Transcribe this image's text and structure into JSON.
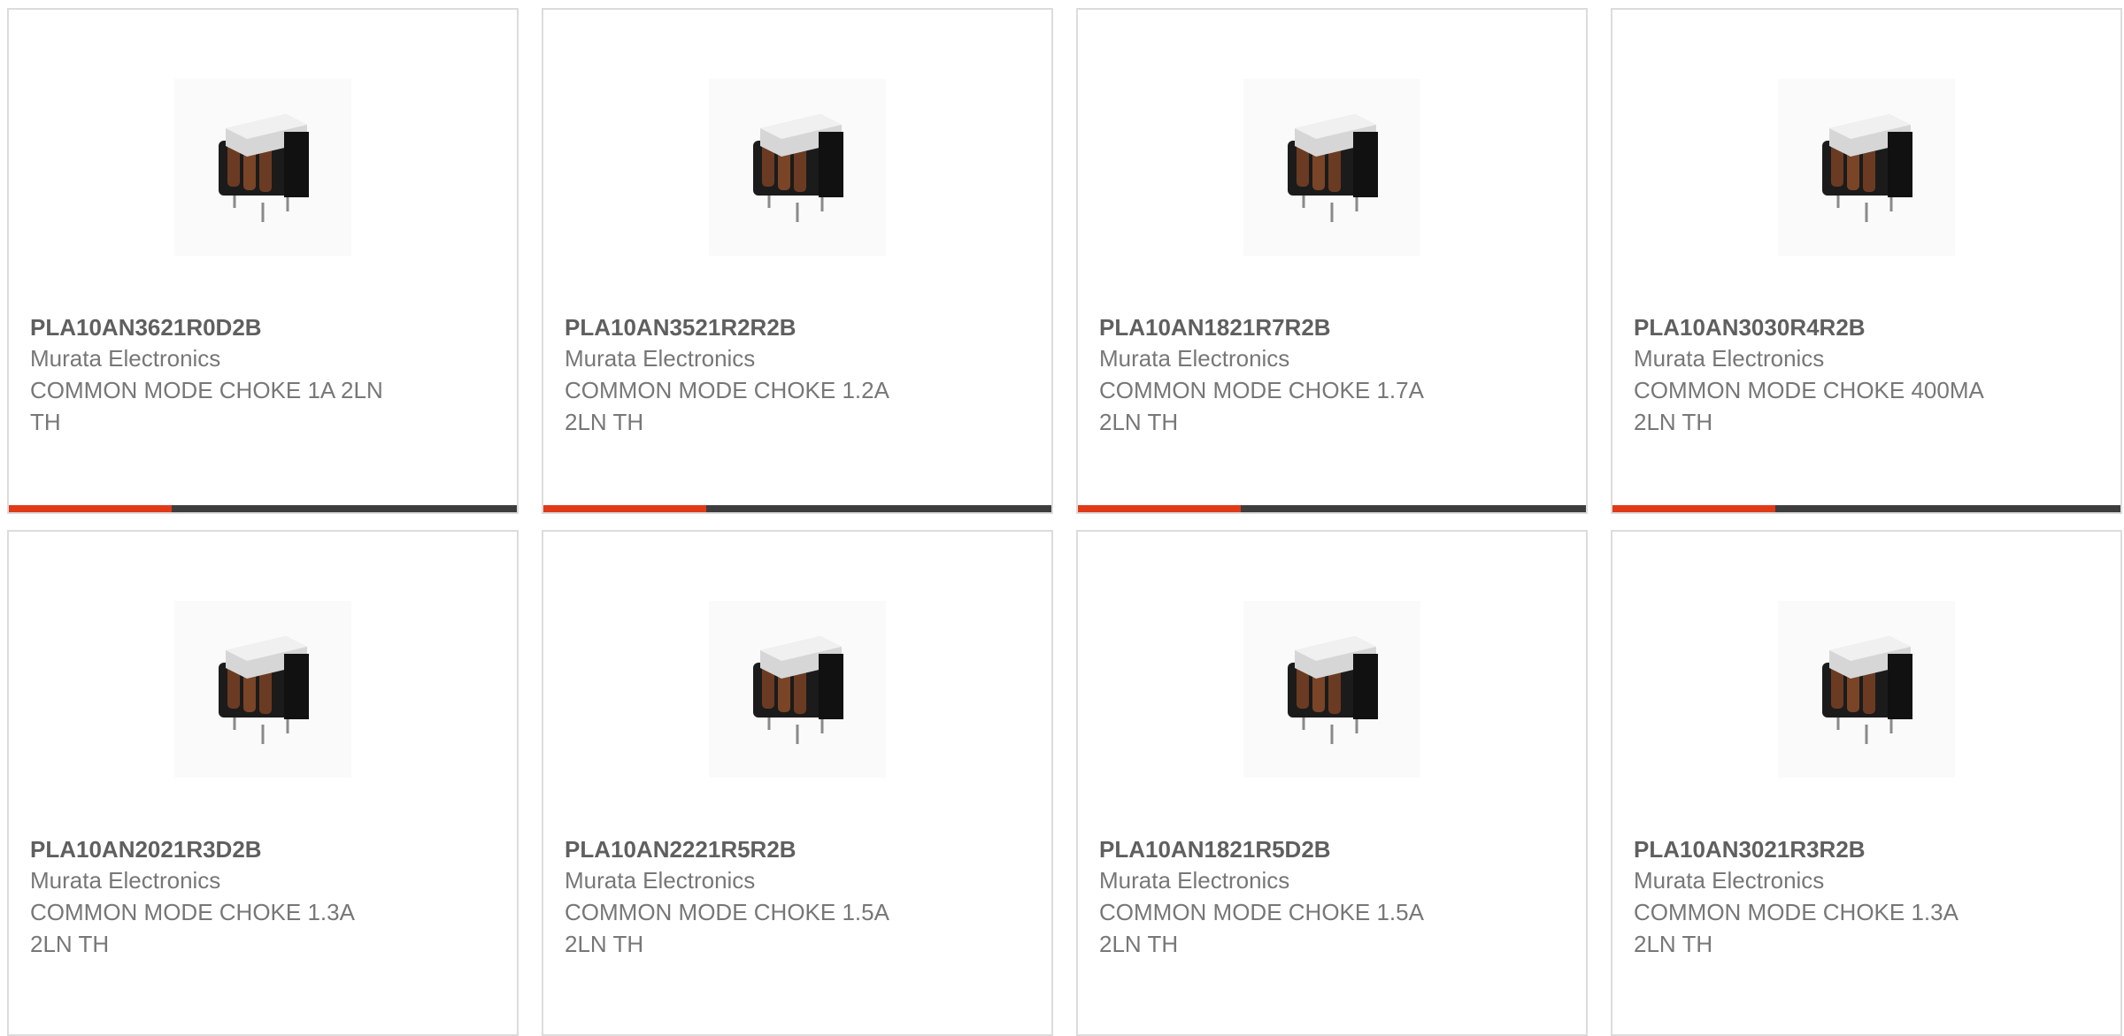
{
  "colors": {
    "accent": "#e03a18",
    "progress_track": "#3d3d3d",
    "card_border": "#dcdcdc",
    "title_text": "#5f5f5f",
    "body_text": "#777777"
  },
  "products": [
    {
      "part_number": "PLA10AN3621R0D2B",
      "manufacturer": "Murata Electronics",
      "description": "COMMON MODE CHOKE 1A 2LN TH",
      "image_icon": "common-mode-choke-icon",
      "progress_fraction": 0.32
    },
    {
      "part_number": "PLA10AN3521R2R2B",
      "manufacturer": "Murata Electronics",
      "description": "COMMON MODE CHOKE 1.2A 2LN TH",
      "image_icon": "common-mode-choke-icon",
      "progress_fraction": 0.32
    },
    {
      "part_number": "PLA10AN1821R7R2B",
      "manufacturer": "Murata Electronics",
      "description": "COMMON MODE CHOKE 1.7A 2LN TH",
      "image_icon": "common-mode-choke-icon",
      "progress_fraction": 0.32
    },
    {
      "part_number": "PLA10AN3030R4R2B",
      "manufacturer": "Murata Electronics",
      "description": "COMMON MODE CHOKE 400MA 2LN TH",
      "image_icon": "common-mode-choke-icon",
      "progress_fraction": 0.32
    },
    {
      "part_number": "PLA10AN2021R3D2B",
      "manufacturer": "Murata Electronics",
      "description": "COMMON MODE CHOKE 1.3A 2LN TH",
      "image_icon": "common-mode-choke-icon"
    },
    {
      "part_number": "PLA10AN2221R5R2B",
      "manufacturer": "Murata Electronics",
      "description": "COMMON MODE CHOKE 1.5A 2LN TH",
      "image_icon": "common-mode-choke-icon"
    },
    {
      "part_number": "PLA10AN1821R5D2B",
      "manufacturer": "Murata Electronics",
      "description": "COMMON MODE CHOKE 1.5A 2LN TH",
      "image_icon": "common-mode-choke-icon"
    },
    {
      "part_number": "PLA10AN3021R3R2B",
      "manufacturer": "Murata Electronics",
      "description": "COMMON MODE CHOKE 1.3A 2LN TH",
      "image_icon": "common-mode-choke-icon"
    }
  ]
}
